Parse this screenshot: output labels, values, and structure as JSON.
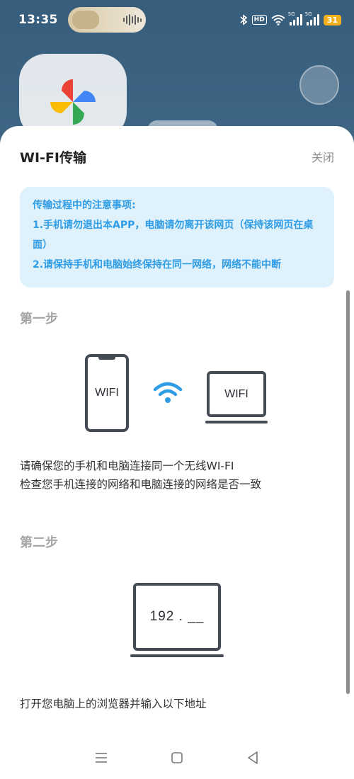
{
  "status_bar": {
    "time": "13:35",
    "hd": "HD",
    "sim1": "5G",
    "sim2": "5G",
    "battery": "31"
  },
  "sheet": {
    "title": "WI-FI传输",
    "close_label": "关闭",
    "notice": {
      "heading": "传输过程中的注意事项:",
      "item1": "1.手机请勿退出本APP，电脑请勿离开该网页（保持该网页在桌面）",
      "item2": "2.请保持手机和电脑始终保持在同一网络，网络不能中断"
    },
    "step1": {
      "title": "第一步",
      "phone_label": "WIFI",
      "laptop_label": "WIFI",
      "line1": "请确保您的手机和电脑连接同一个无线WI-FI",
      "line2": "检查您手机连接的网络和电脑连接的网络是否一致"
    },
    "step2": {
      "title": "第二步",
      "address_hint": "192 . __",
      "instruction": "打开您电脑上的浏览器并输入以下地址"
    }
  },
  "colors": {
    "accent": "#2f9ce6",
    "notice_bg": "#dff1fb",
    "battery": "#f2b01e"
  },
  "icons": [
    "bluetooth-icon",
    "wifi-status-icon",
    "signal-icon",
    "battery-icon",
    "wifi-icon",
    "menu-icon",
    "home-icon",
    "back-icon"
  ]
}
